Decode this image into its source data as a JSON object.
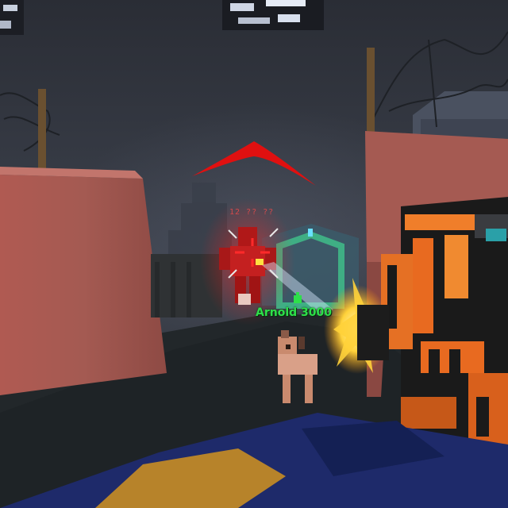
{
  "hud": {
    "player_nametag": "Arnold 3000",
    "enemy_nametag": "12 ?? ??"
  },
  "icons": {
    "crosshair": "crosshair-icon",
    "threat_indicator": "threat-arrow-icon",
    "player_marker": "player-marker-icon"
  },
  "colors": {
    "crosshair": "#ff2a2a",
    "threat_indicator": "#e01010",
    "nametag": "#2ee04a",
    "enemy_glow": "#ff2020",
    "muzzle_flash": "#ffd23a"
  }
}
